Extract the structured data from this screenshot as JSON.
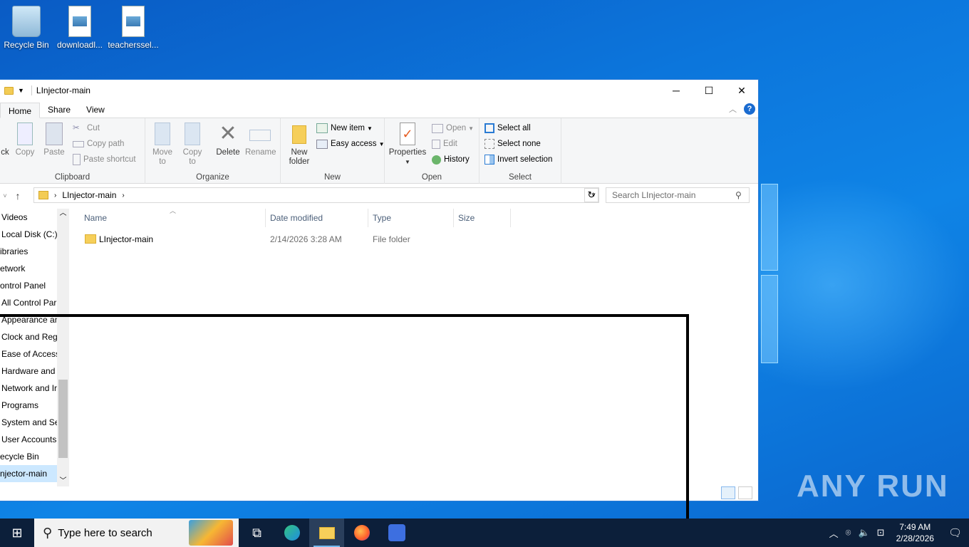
{
  "desktop": {
    "icons": [
      {
        "label": "Recycle Bin"
      },
      {
        "label": "downloadl..."
      },
      {
        "label": "teacherssel..."
      }
    ],
    "watermark": "ANY RUN"
  },
  "window": {
    "title": "LInjector-main",
    "tabs": [
      "Home",
      "Share",
      "View"
    ],
    "ribbon": {
      "clipboard": {
        "label": "Clipboard",
        "pin": "ck",
        "copy": "Copy",
        "paste": "Paste",
        "cut": "Cut",
        "copy_path": "Copy path",
        "paste_shortcut": "Paste shortcut"
      },
      "organize": {
        "label": "Organize",
        "move_to": "Move to",
        "copy_to": "Copy to",
        "delete": "Delete",
        "rename": "Rename"
      },
      "new": {
        "label": "New",
        "new_folder": "New folder",
        "new_item": "New item",
        "easy_access": "Easy access"
      },
      "open": {
        "label": "Open",
        "properties": "Properties",
        "open": "Open",
        "edit": "Edit",
        "history": "History"
      },
      "select": {
        "label": "Select",
        "select_all": "Select all",
        "select_none": "Select none",
        "invert": "Invert selection"
      }
    },
    "address": {
      "path": "LInjector-main",
      "search_placeholder": "Search LInjector-main"
    },
    "nav": [
      {
        "label": "Videos",
        "selected": false
      },
      {
        "label": "Local Disk (C:)",
        "selected": false
      },
      {
        "label": "ibraries",
        "selected": false
      },
      {
        "label": "etwork",
        "selected": false
      },
      {
        "label": "ontrol Panel",
        "selected": false
      },
      {
        "label": "All Control Par",
        "selected": false
      },
      {
        "label": "Appearance an",
        "selected": false
      },
      {
        "label": "Clock and Regi",
        "selected": false
      },
      {
        "label": "Ease of Access",
        "selected": false
      },
      {
        "label": "Hardware and",
        "selected": false
      },
      {
        "label": "Network and Ir",
        "selected": false
      },
      {
        "label": "Programs",
        "selected": false
      },
      {
        "label": "System and Sec",
        "selected": false
      },
      {
        "label": "User Accounts",
        "selected": false
      },
      {
        "label": "ecycle Bin",
        "selected": false
      },
      {
        "label": "njector-main",
        "selected": true
      }
    ],
    "columns": [
      "Name",
      "Date modified",
      "Type",
      "Size"
    ],
    "files": [
      {
        "name": "LInjector-main",
        "date": "2/14/2026 3:28 AM",
        "type": "File folder",
        "size": ""
      }
    ]
  },
  "taskbar": {
    "search_placeholder": "Type here to search",
    "time": "7:49 AM",
    "date": "2/28/2026"
  }
}
